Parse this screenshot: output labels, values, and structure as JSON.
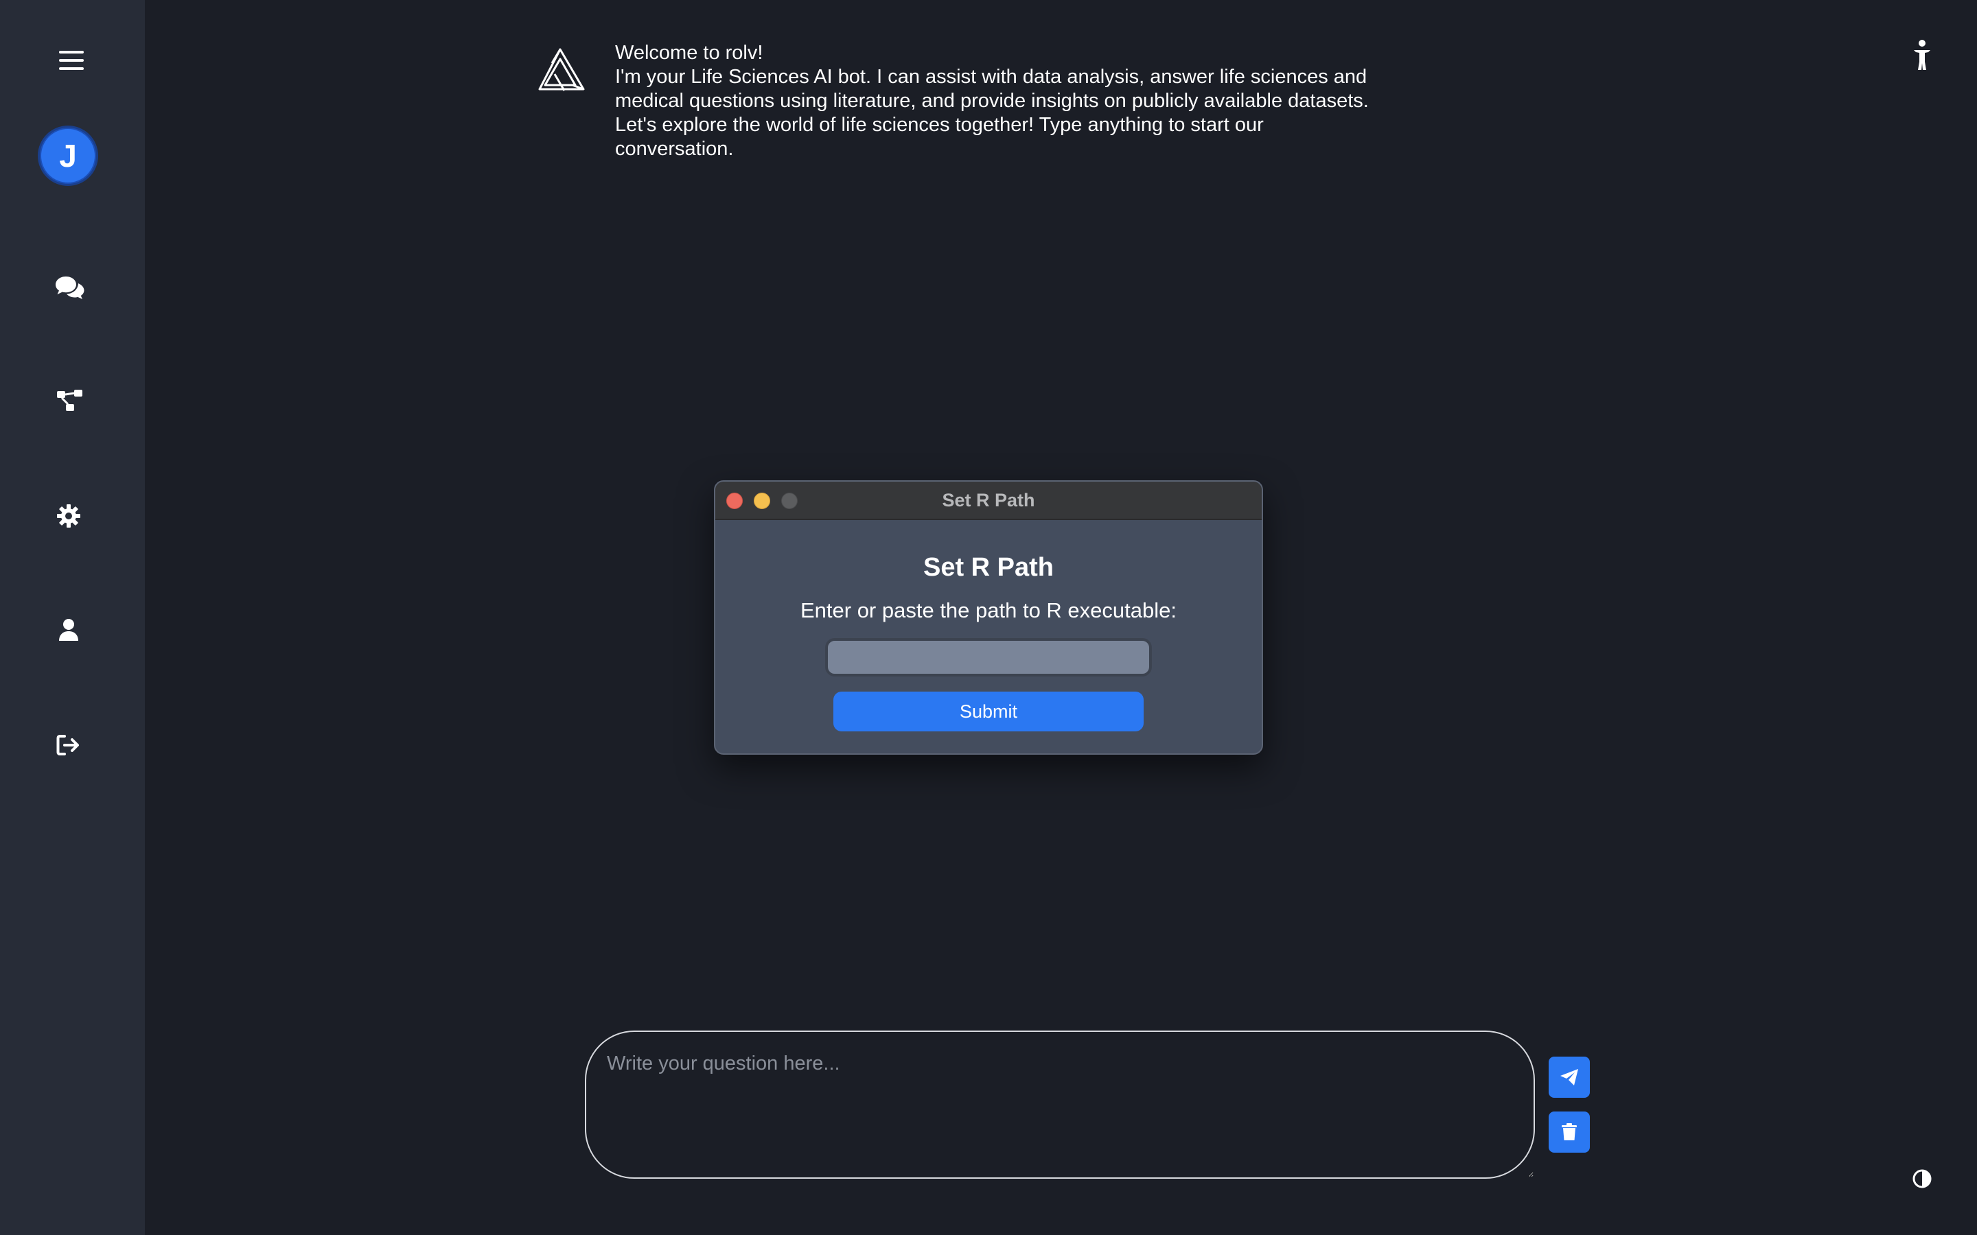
{
  "sidebar": {
    "avatar_initial": "J",
    "items": [
      {
        "icon": "menu-icon"
      },
      {
        "icon": "chat-icon"
      },
      {
        "icon": "workflow-icon"
      },
      {
        "icon": "gear-icon"
      },
      {
        "icon": "user-icon"
      },
      {
        "icon": "logout-icon"
      }
    ]
  },
  "welcome": {
    "line1": "Welcome to rolv!",
    "line2": "I'm your Life Sciences AI bot. I can assist with data analysis, answer life sciences and medical questions using literature, and provide insights on publicly available datasets. Let's explore the world of life sciences together! Type anything to start our conversation."
  },
  "modal": {
    "window_title": "Set R Path",
    "heading": "Set R Path",
    "prompt": "Enter or paste the path to R executable:",
    "input_value": "",
    "submit_label": "Submit"
  },
  "chat": {
    "placeholder": "Write your question here...",
    "value": ""
  },
  "colors": {
    "background": "#1b1e26",
    "sidebar": "#272c37",
    "accent": "#2b78f2",
    "modal": "#444d5e"
  }
}
